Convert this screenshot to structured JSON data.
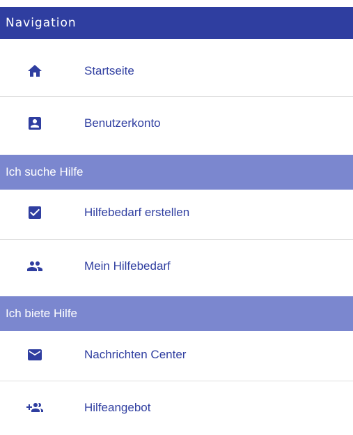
{
  "navigation": {
    "title": "Navigation"
  },
  "items": [
    {
      "label": "Startseite",
      "icon": "home-icon"
    },
    {
      "label": "Benutzerkonto",
      "icon": "account-box-icon"
    }
  ],
  "sections": [
    {
      "title": "Ich suche Hilfe",
      "items": [
        {
          "label": "Hilfebedarf erstellen",
          "icon": "checkbox-icon"
        },
        {
          "label": "Mein Hilfebedarf",
          "icon": "people-icon"
        }
      ]
    },
    {
      "title": "Ich biete Hilfe",
      "items": [
        {
          "label": "Nachrichten Center",
          "icon": "mail-icon"
        },
        {
          "label": "Hilfeangebot",
          "icon": "group-add-icon"
        }
      ]
    }
  ],
  "colors": {
    "header_bg": "#2f3ea0",
    "section_bg": "#7b87cf",
    "accent": "#2f3ea0",
    "divider": "#e0e0e0"
  }
}
